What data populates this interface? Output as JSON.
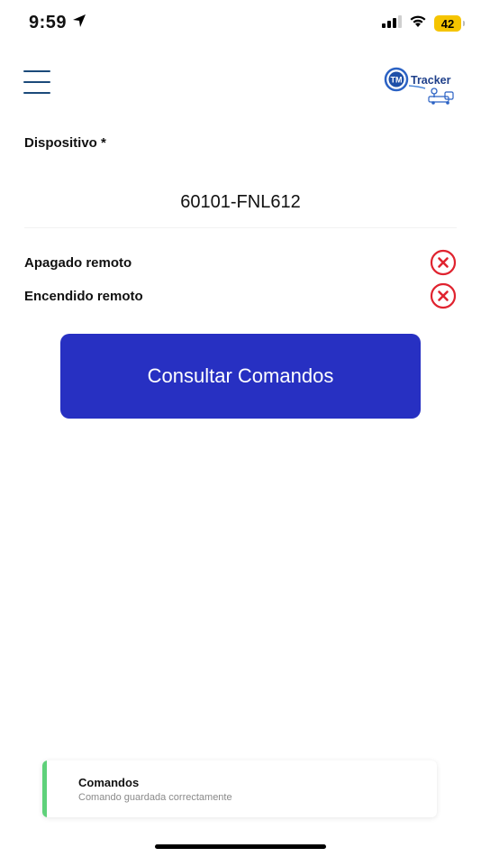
{
  "status_bar": {
    "time": "9:59",
    "battery_level": "42",
    "icons": [
      "location-arrow-icon",
      "signal-icon",
      "wifi-icon",
      "battery-icon"
    ],
    "battery_color": "#f5c400"
  },
  "header": {
    "menu_icon": "hamburger-menu-icon",
    "logo": {
      "badge": "TM",
      "name": "Tracker"
    }
  },
  "form": {
    "device_label": "Dispositivo *",
    "device_value": "60101-FNL612"
  },
  "commands": [
    {
      "label": "Apagado remoto",
      "status_icon": "error-x-circle-icon"
    },
    {
      "label": "Encendido remoto",
      "status_icon": "error-x-circle-icon"
    }
  ],
  "action_button": {
    "label": "Consultar Comandos",
    "color": "#2730c2"
  },
  "toast": {
    "title": "Comandos",
    "message": "Comando guardada correctamente",
    "accent_color": "#5fd17a"
  },
  "colors": {
    "error": "#e0232f",
    "menu": "#1b4a7a"
  }
}
